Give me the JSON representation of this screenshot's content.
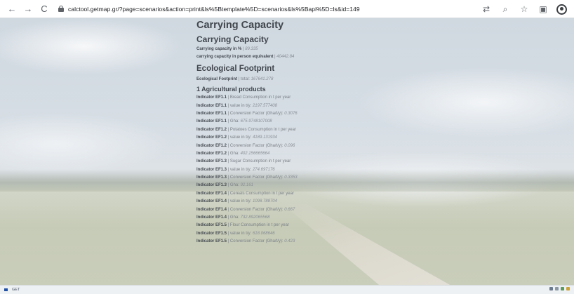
{
  "browser": {
    "back_icon": "←",
    "forward_icon": "→",
    "reload_icon": "C",
    "url": "calctool.getmap.gr/?page=scenarios&action=print&ls%5Btemplate%5D=scenarios&ls%5Bapi%5D=ls&id=149",
    "translate_icon": "⇄",
    "zoom_icon": "⌕",
    "star_icon": "☆",
    "extensions_icon": "▣"
  },
  "page": {
    "title": "Carrying Capacity",
    "carrying": {
      "heading": "Carrying Capacity",
      "rows": [
        {
          "label": "Carrying capacity in %",
          "sep": " | ",
          "value": "89.335"
        },
        {
          "label": "carrying capacity in person equivalent",
          "sep": " | ",
          "value": "40442.84"
        }
      ]
    },
    "footprint": {
      "heading": "Ecological Footprint",
      "total_label": "Ecological Footprint",
      "total_sep": " | total: ",
      "total_value": "167641.278",
      "category": "1 Agricultural products",
      "rows": [
        {
          "label": "Indicator EF1.1",
          "sep": " | ",
          "text": "Bread Consumption in t per year",
          "value": ""
        },
        {
          "label": "Indicator EF1.1",
          "sep": " | value in t/y: ",
          "text": "",
          "value": "2197.577408"
        },
        {
          "label": "Indicator EF1.1",
          "sep": " | Conversion Factor (Gha/t/y): ",
          "text": "",
          "value": "0.3076"
        },
        {
          "label": "Indicator EF1.1",
          "sep": " | Gha: ",
          "text": "",
          "value": "675.9748107008"
        },
        {
          "label": "Indicator EF1.2",
          "sep": " | ",
          "text": "Potatoes Consumption in t per year",
          "value": ""
        },
        {
          "label": "Indicator EF1.2",
          "sep": " | value in t/y: ",
          "text": "",
          "value": "4189.131934"
        },
        {
          "label": "Indicator EF1.2",
          "sep": " | Conversion Factor (Gha/t/y): ",
          "text": "",
          "value": "0.096"
        },
        {
          "label": "Indicator EF1.2",
          "sep": " | Gha: ",
          "text": "",
          "value": "402.156665664"
        },
        {
          "label": "Indicator EF1.3",
          "sep": " | ",
          "text": "Sugar Consumption in t per year",
          "value": ""
        },
        {
          "label": "Indicator EF1.3",
          "sep": " | value in t/y: ",
          "text": "",
          "value": "274.697176"
        },
        {
          "label": "Indicator EF1.3",
          "sep": " | Conversion Factor (Gha/t/y): ",
          "text": "",
          "value": "0.3353"
        },
        {
          "label": "Indicator EF1.3",
          "sep": " | Gha: ",
          "text": "",
          "value": "92.161"
        },
        {
          "label": "Indicator EF1.4",
          "sep": " | ",
          "text": "Cereals Consumption in t per year",
          "value": ""
        },
        {
          "label": "Indicator EF1.4",
          "sep": " | value in t/y: ",
          "text": "",
          "value": "1098.788704"
        },
        {
          "label": "Indicator EF1.4",
          "sep": " | Conversion Factor (Gha/t/y): ",
          "text": "",
          "value": "0.667"
        },
        {
          "label": "Indicator EF1.4",
          "sep": " | Gha: ",
          "text": "",
          "value": "732.892065568"
        },
        {
          "label": "Indicator EF1.5",
          "sep": " | ",
          "text": "Flour Consumption in t per year",
          "value": ""
        },
        {
          "label": "Indicator EF1.5",
          "sep": " | value in t/y: ",
          "text": "",
          "value": "618.068646"
        },
        {
          "label": "Indicator EF1.5",
          "sep": " | Conversion Factor (Gha/t/y): ",
          "text": "",
          "value": "0.423"
        }
      ]
    }
  },
  "taskbar": {
    "item1": "",
    "item2": "GET"
  },
  "colors": {
    "heading": "#41464d",
    "label": "#454a51",
    "muted": "#7b8087"
  }
}
